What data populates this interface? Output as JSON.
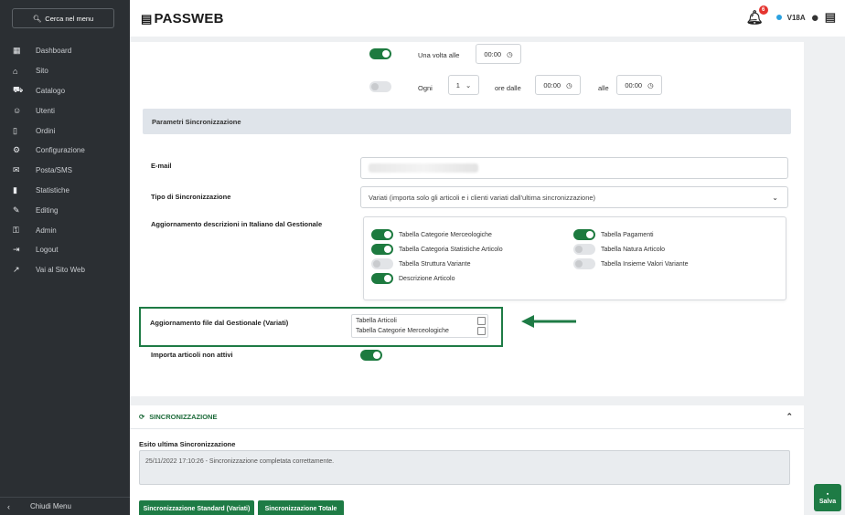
{
  "sidebar": {
    "search_label": "Cerca nel menu",
    "items": [
      {
        "label": "Dashboard",
        "icon": "dashboard-icon",
        "glyph": "▦"
      },
      {
        "label": "Sito",
        "icon": "home-icon",
        "glyph": "⌂"
      },
      {
        "label": "Catalogo",
        "icon": "cart-icon",
        "glyph": "⛟"
      },
      {
        "label": "Utenti",
        "icon": "users-icon",
        "glyph": "☺"
      },
      {
        "label": "Ordini",
        "icon": "file-icon",
        "glyph": "▯"
      },
      {
        "label": "Configurazione",
        "icon": "gear-icon",
        "glyph": "⚙"
      },
      {
        "label": "Posta/SMS",
        "icon": "mail-icon",
        "glyph": "✉"
      },
      {
        "label": "Statistiche",
        "icon": "bar-chart-icon",
        "glyph": "▮"
      },
      {
        "label": "Editing",
        "icon": "pencil-icon",
        "glyph": "✎"
      },
      {
        "label": "Admin",
        "icon": "lock-icon",
        "glyph": "⚿"
      },
      {
        "label": "Logout",
        "icon": "logout-icon",
        "glyph": "⇥"
      },
      {
        "label": "Vai al Sito Web",
        "icon": "external-link-icon",
        "glyph": "↗"
      }
    ],
    "collapse_label": "Chiudi Menu"
  },
  "header": {
    "logo": "PASSWEB",
    "notification_count": "6",
    "user_code": "V18A"
  },
  "schedule": {
    "once_label": "Una volta alle",
    "once_time": "00:00",
    "every_label": "Ogni",
    "every_value": "1",
    "from_label": "ore dalle",
    "from_time": "00:00",
    "to_label": "alle",
    "to_time": "00:00"
  },
  "params_section_title": "Parametri Sincronizzazione",
  "email_label": "E-mail",
  "sync_type": {
    "label": "Tipo di Sincronizzazione",
    "value": "Variati (importa solo gli articoli e i clienti variati dall'ultima sincronizzazione)"
  },
  "descriptions": {
    "label": "Aggiornamento descrizioni in Italiano dal Gestionale",
    "left": [
      {
        "label": "Tabella Categorie Merceologiche",
        "on": true
      },
      {
        "label": "Tabella Categoria Statistiche Articolo",
        "on": true
      },
      {
        "label": "Tabella Struttura Variante",
        "on": false
      },
      {
        "label": "Descrizione Articolo",
        "on": true
      }
    ],
    "right": [
      {
        "label": "Tabella Pagamenti",
        "on": true
      },
      {
        "label": "Tabella Natura Articolo",
        "on": false
      },
      {
        "label": "Tabella Insieme Valori Variante",
        "on": false
      }
    ]
  },
  "file_update": {
    "label": "Aggiornamento file dal Gestionale (Variati)",
    "items": [
      "Tabella Articoli",
      "Tabella Categorie Merceologiche"
    ]
  },
  "inactive_label": "Importa articoli non attivi",
  "sync_panel": {
    "title": "SINCRONIZZAZIONE",
    "result_label": "Esito ultima Sincronizzazione",
    "result_text": "25/11/2022 17:10:26 - Sincronizzazione  completata correttamente.",
    "btn_standard": "Sincronizzazione Standard (Variati)",
    "btn_total": "Sincronizzazione Totale"
  },
  "save_label": "Salva",
  "colors": {
    "accent": "#1e7b45",
    "sidebar": "#2b2f33"
  }
}
